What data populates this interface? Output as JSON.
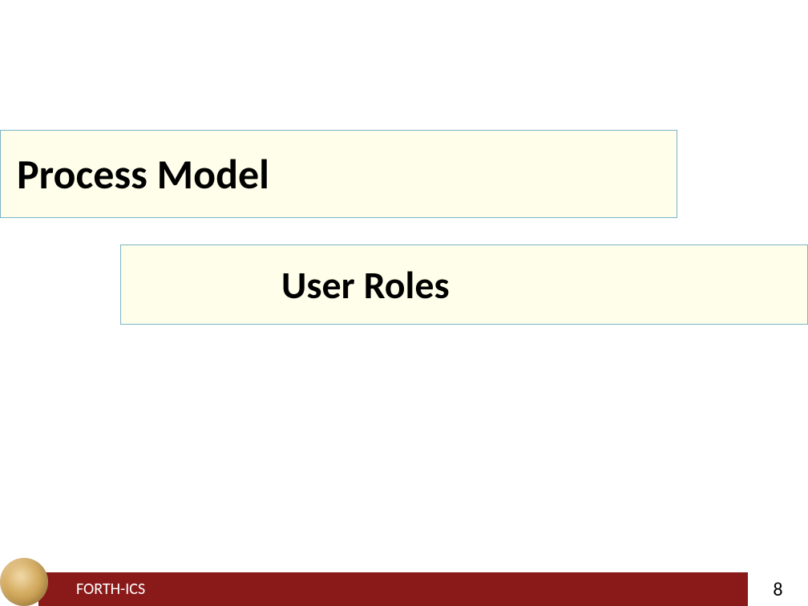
{
  "slide": {
    "title1": "Process Model",
    "title2": "User Roles"
  },
  "footer": {
    "organization": "FORTH-ICS",
    "page_number": "8"
  }
}
